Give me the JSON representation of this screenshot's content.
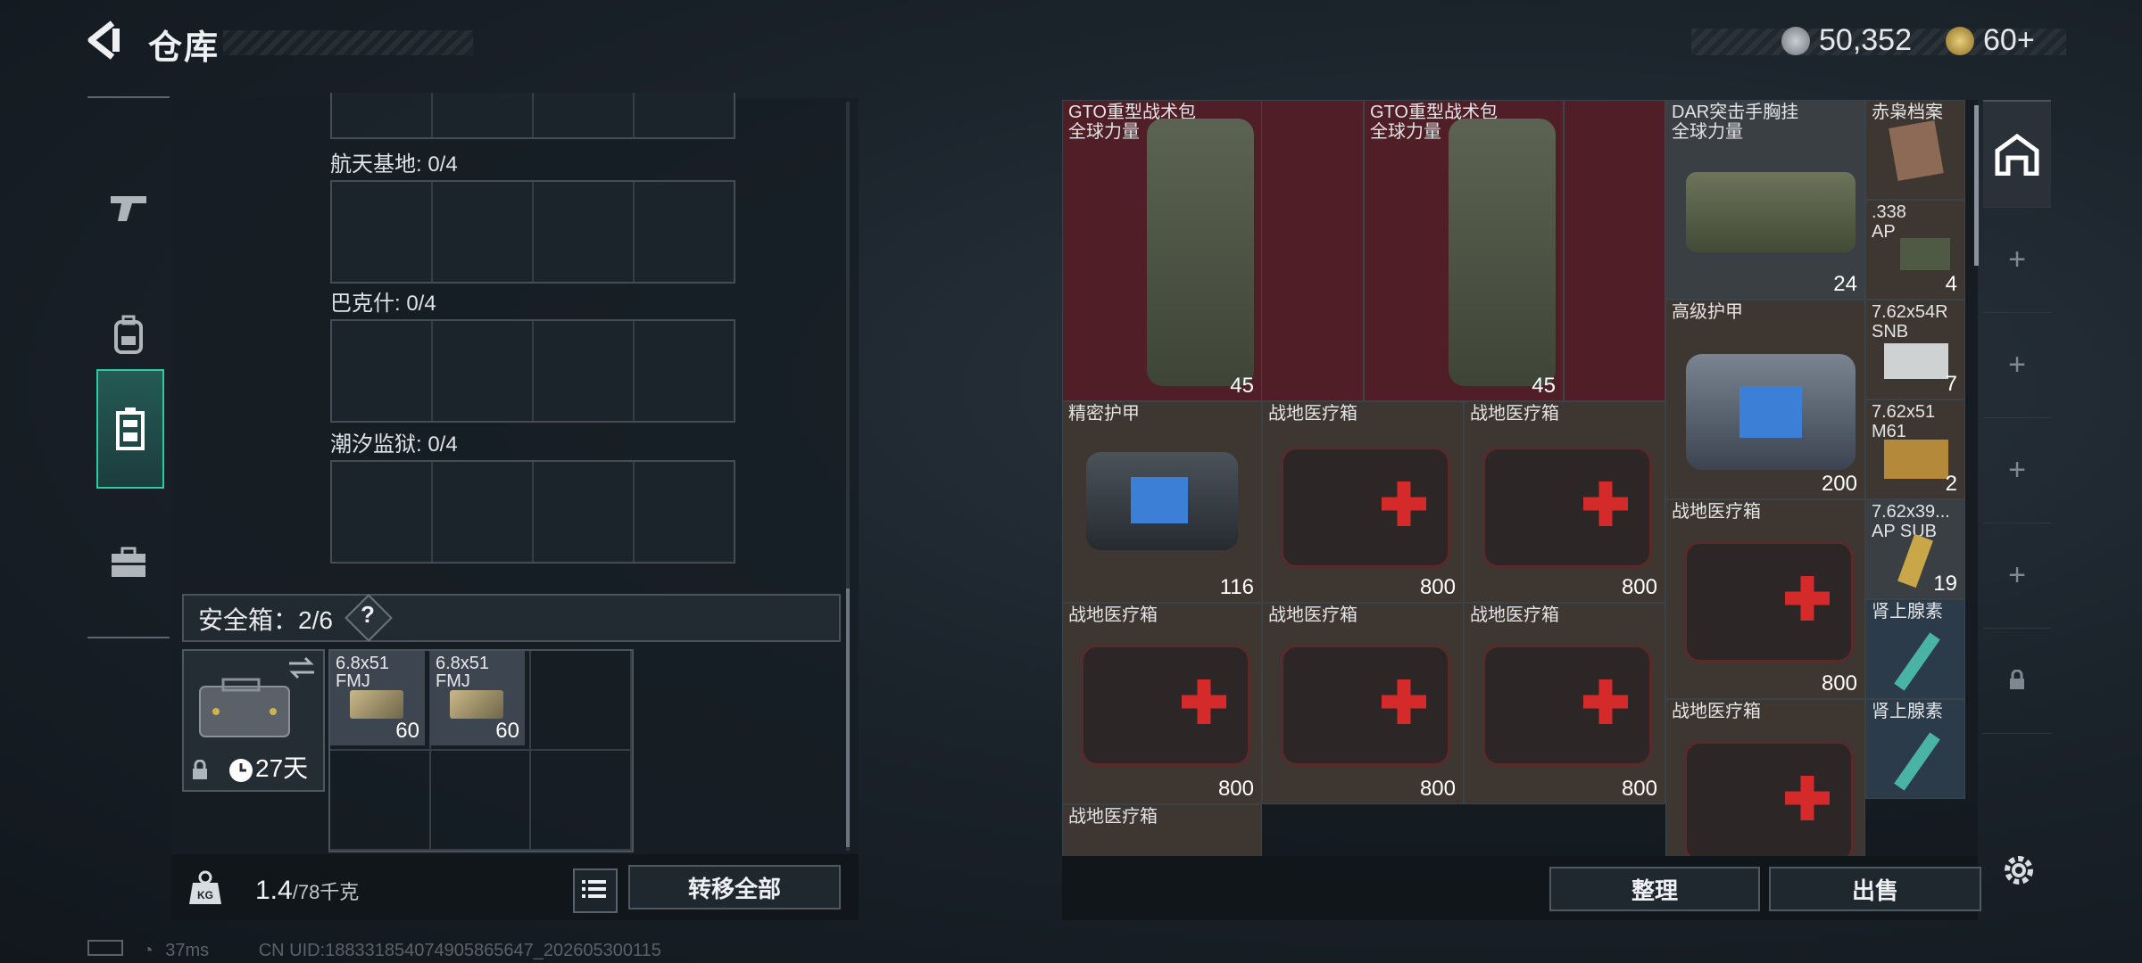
{
  "header": {
    "title": "仓库",
    "currency_a": "50,352",
    "currency_b": "60+"
  },
  "stash": {
    "sections": [
      {
        "label": "航天基地: 0/4"
      },
      {
        "label": "巴克什: 0/4"
      },
      {
        "label": "潮汐监狱: 0/4"
      }
    ],
    "safe_box_label": "安全箱：2/6",
    "safe_help": "?",
    "case_timer": "27天",
    "safe_items": [
      {
        "name": "6.8x51\nFMJ",
        "count": "60"
      },
      {
        "name": "6.8x51\nFMJ",
        "count": "60"
      }
    ],
    "weight_value": "1.4",
    "weight_cap": "/78千克",
    "transfer_all": "转移全部"
  },
  "loot": {
    "items": [
      {
        "name": "GTO重型战术包\n全球力量",
        "value": "45"
      },
      {
        "name": "GTO重型战术包\n全球力量",
        "value": "45"
      },
      {
        "name": "DAR突击手胸挂\n全球力量",
        "value": "24"
      },
      {
        "name": "赤枭档案",
        "value": ""
      },
      {
        "name": ".338\nAP",
        "value": "4"
      },
      {
        "name": "高级护甲",
        "value": "200"
      },
      {
        "name": "7.62x54R\nSNB",
        "value": "7"
      },
      {
        "name": "精密护甲",
        "value": "116"
      },
      {
        "name": "战地医疗箱",
        "value": "800"
      },
      {
        "name": "战地医疗箱",
        "value": "800"
      },
      {
        "name": "7.62x51\nM61",
        "value": "2"
      },
      {
        "name": "战地医疗箱",
        "value": "800"
      },
      {
        "name": "7.62x39...\nAP SUB",
        "value": "19"
      },
      {
        "name": "战地医疗箱",
        "value": "800"
      },
      {
        "name": "战地医疗箱",
        "value": "800"
      },
      {
        "name": "战地医疗箱",
        "value": "800"
      },
      {
        "name": "肾上腺素",
        "value": ""
      },
      {
        "name": "战地医疗箱",
        "value": ""
      },
      {
        "name": "肾上腺素",
        "value": ""
      },
      {
        "name": "战地医疗箱",
        "value": ""
      }
    ],
    "sort_label": "整理",
    "sell_label": "出售"
  },
  "status": {
    "ping": "37ms",
    "uid": "CN UID:18833185407490586564​7_202605300115"
  },
  "colors": {
    "accent": "#2fc9a6",
    "red_rarity": "#4f1e26",
    "blue_rarity": "#2c3b4a"
  }
}
